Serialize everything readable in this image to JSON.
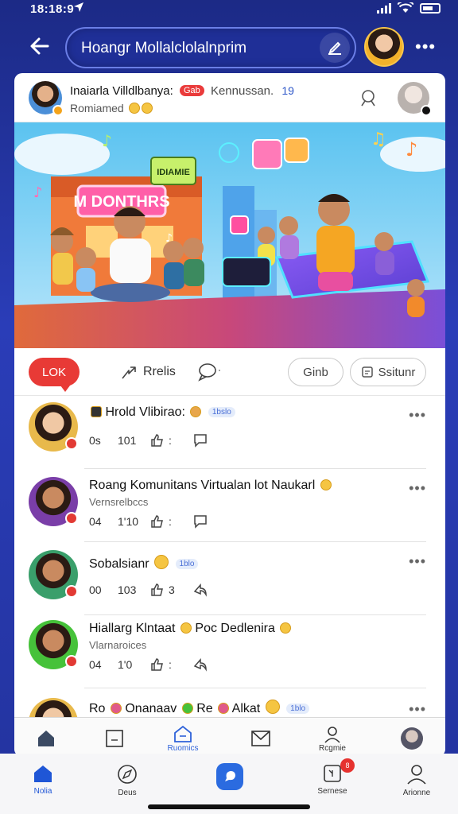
{
  "status_bar": {
    "time": "18:18:9"
  },
  "top_bar": {
    "search_text": "Hoangr Mollalclolalnprim"
  },
  "post": {
    "author": "Inaiarla Villdlbanya:",
    "badge": "Gab",
    "group": "Kennussan.",
    "count": "19",
    "subtitle": "Romiamed"
  },
  "hero": {
    "sign1": "M DONTHRS",
    "sign2": "IDIAMIE"
  },
  "actions": {
    "like_label": "LOK",
    "share_label": "Rrelis",
    "button1_label": "Ginb",
    "button2_label": "Ssitunr"
  },
  "comments": [
    {
      "name": "Hrold Vlibirao:",
      "tag": "1bslo",
      "subtitle": "",
      "count1": "0s",
      "count2": "101",
      "count3": ":"
    },
    {
      "name": "Roang Komunitans Virtualan lot Naukarl",
      "tag": "",
      "subtitle": "Vernsrelbccs",
      "count1": "04",
      "count2": "1'10",
      "count3": ":"
    },
    {
      "name": "Sobalsianr",
      "tag": "1blo",
      "subtitle": "",
      "count1": "00",
      "count2": "103",
      "count3": "3"
    },
    {
      "name": "Hiallarg Klntaat",
      "name2": "Poc Dedlenira",
      "tag": "",
      "subtitle": "Vlarnaroices",
      "count1": "04",
      "count2": "1'0",
      "count3": ":"
    },
    {
      "name": "Ro",
      "name2": "Onanaav",
      "name3": "Re",
      "name4": "Alkat",
      "tag": "1blo",
      "subtitle": "",
      "count1": "",
      "count2": "",
      "count3": ""
    }
  ],
  "inner_tabs": {
    "active_label": "Ruomics",
    "profile_label": "Rcgmie"
  },
  "bottom_nav": {
    "home": "Nolia",
    "discover": "Deus",
    "services": "Sernese",
    "services_badge": "8",
    "account": "Arionne"
  },
  "colors": {
    "accent": "#2b6be0",
    "like": "#e83a36",
    "header_bg": "#23339e"
  }
}
